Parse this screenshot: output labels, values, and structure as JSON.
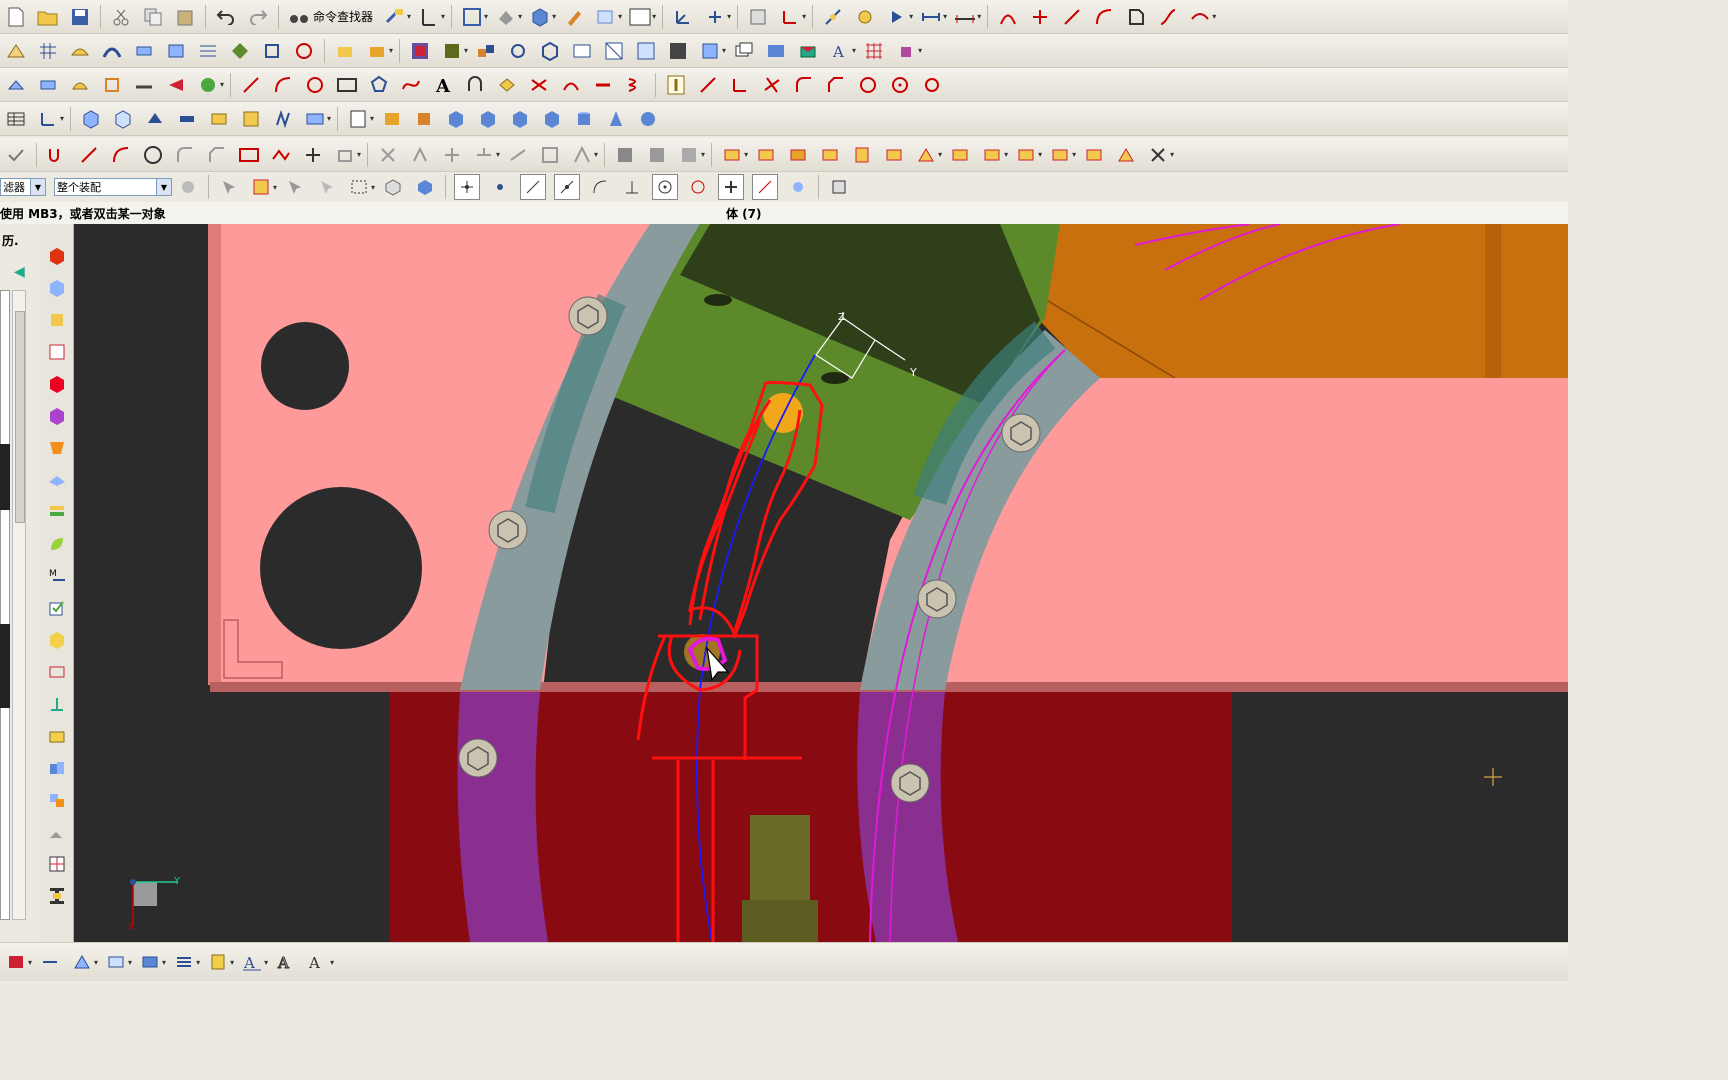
{
  "toolbar": {
    "command_finder_label": "命令查找器"
  },
  "selection": {
    "filter_label": "滤器",
    "scope_value": "整个装配"
  },
  "status": {
    "prompt": "使用 MB3，或者双击某一对象",
    "selection_info": "体 (7)"
  },
  "left_panel": {
    "history_label": "历."
  },
  "viewport": {
    "csys_x_label": "X",
    "csys_y_label": "Y",
    "csys_z_label": "Z",
    "colors": {
      "background": "#2b2b2b",
      "plate": "#ff9a9a",
      "plate_edge": "#c96f6f",
      "ring_gray": "#8a9b9e",
      "ring_teal": "#3d7f7a",
      "ring_magenta": "#8a2f8f",
      "block_green": "#5c8a2a",
      "block_dark": "#2f3f1a",
      "block_orange": "#c8700e",
      "base_red": "#8a0a12",
      "annotation_red": "#ff1010",
      "path_blue": "#1a1aff",
      "curve_magenta": "#e01ad8"
    }
  }
}
